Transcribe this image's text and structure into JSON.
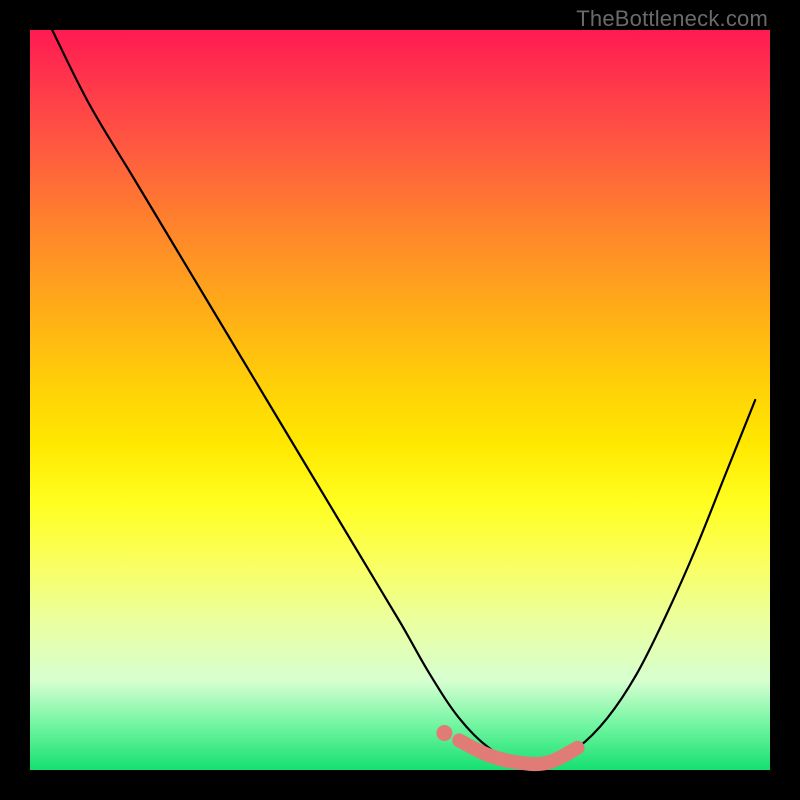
{
  "watermark": "TheBottleneck.com",
  "chart_data": {
    "type": "line",
    "title": "",
    "xlabel": "",
    "ylabel": "",
    "xlim": [
      0,
      100
    ],
    "ylim": [
      0,
      100
    ],
    "grid": false,
    "series": [
      {
        "name": "bottleneck-curve",
        "color": "#000000",
        "x": [
          3,
          8,
          14,
          20,
          26,
          32,
          38,
          44,
          50,
          54,
          58,
          62,
          66,
          70,
          74,
          78,
          82,
          86,
          90,
          94,
          98
        ],
        "values": [
          100,
          90,
          80,
          70,
          60,
          50,
          40,
          30,
          20,
          13,
          7,
          3,
          1,
          1,
          3,
          7,
          13,
          21,
          30,
          40,
          50
        ]
      },
      {
        "name": "highlight-strip",
        "color": "#e07c75",
        "x": [
          58,
          62,
          66,
          70,
          74
        ],
        "values": [
          4,
          2,
          1,
          1,
          3
        ]
      }
    ],
    "annotations": [
      {
        "name": "highlight-dot",
        "x": 56,
        "y": 5,
        "color": "#e07c75"
      }
    ]
  }
}
